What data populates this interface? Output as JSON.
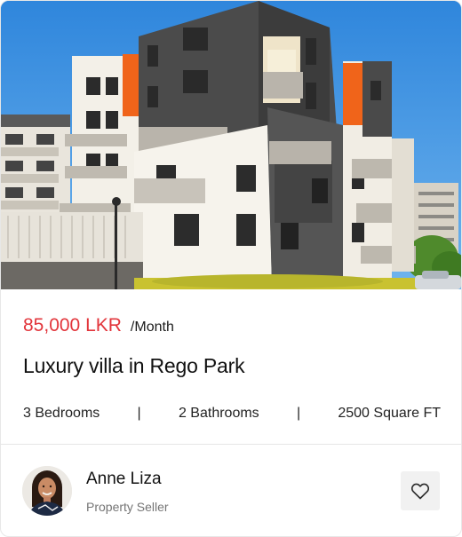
{
  "listing": {
    "image_alt": "Modern apartment building",
    "price": "85,000 LKR",
    "period": "/Month",
    "title": "Luxury villa in Rego Park",
    "features": {
      "bedrooms": "3 Bedrooms",
      "bathrooms": "2 Bathrooms",
      "area": "2500 Square FT"
    },
    "separator": "|"
  },
  "seller": {
    "name": "Anne Liza",
    "role": "Property Seller"
  },
  "actions": {
    "favorite_icon": "heart-icon"
  },
  "colors": {
    "price": "#e2353b",
    "accent_orange": "#f0641a",
    "sky": "#3a8fe0"
  }
}
